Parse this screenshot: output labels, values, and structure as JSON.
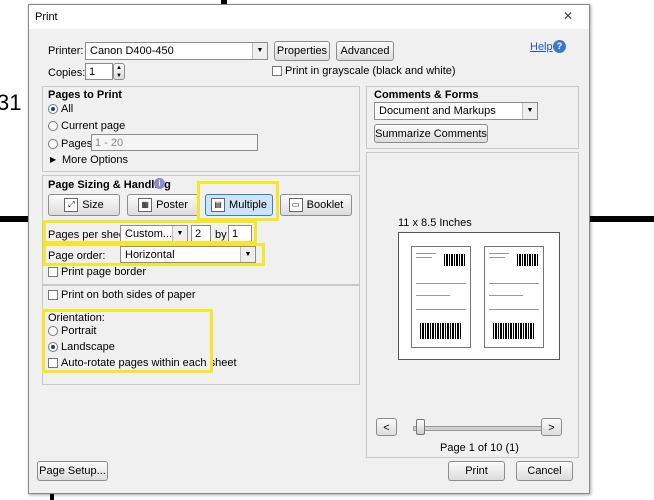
{
  "background": {
    "number": "31"
  },
  "window": {
    "title": "Print",
    "close_glyph": "✕"
  },
  "printer": {
    "label": "Printer:",
    "value": "Canon D400-450",
    "properties_label": "Properties",
    "advanced_label": "Advanced",
    "help_label": "Help",
    "copies_label": "Copies:",
    "copies_value": "1",
    "grayscale_label": "Print in grayscale (black and white)"
  },
  "pages_to_print": {
    "title": "Pages to Print",
    "all_label": "All",
    "current_label": "Current page",
    "pages_label": "Pages",
    "pages_value": "1 - 20",
    "more_options_label": "More Options"
  },
  "sizing": {
    "title": "Page Sizing & Handling",
    "size_label": "Size",
    "poster_label": "Poster",
    "multiple_label": "Multiple",
    "booklet_label": "Booklet",
    "pages_per_sheet_label": "Pages per sheet:",
    "pages_per_sheet_value": "Custom...",
    "cols_value": "2",
    "by_label": "by",
    "rows_value": "1",
    "page_order_label": "Page order:",
    "page_order_value": "Horizontal",
    "page_border_label": "Print page border",
    "both_sides_label": "Print on both sides of paper",
    "orientation_label": "Orientation:",
    "portrait_label": "Portrait",
    "landscape_label": "Landscape",
    "autorotate_label": "Auto-rotate pages within each sheet"
  },
  "comments": {
    "title": "Comments & Forms",
    "value": "Document and Markups",
    "summarize_label": "Summarize Comments"
  },
  "preview": {
    "size_label": "11 x 8.5 Inches",
    "prev_glyph": "<",
    "next_glyph": ">",
    "page_label": "Page 1 of 10 (1)",
    "slider_position": 0.0
  },
  "footer": {
    "page_setup_label": "Page Setup...",
    "print_label": "Print",
    "cancel_label": "Cancel"
  },
  "colors": {
    "highlight": "#f2e829",
    "help_blue": "#2255bb",
    "multiple_active": "#cde3f7"
  }
}
